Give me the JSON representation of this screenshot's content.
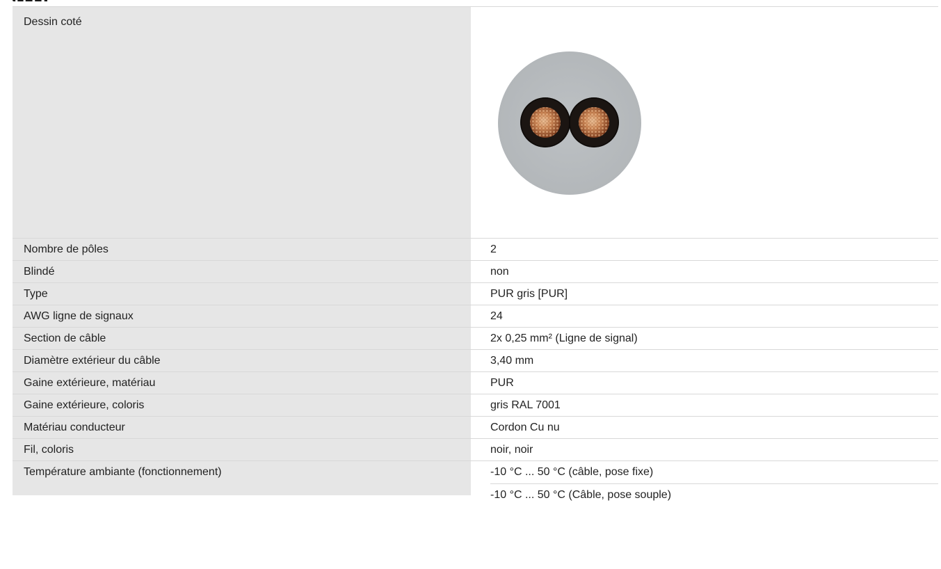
{
  "specs": {
    "drawing_label": "Dessin coté",
    "rows": [
      {
        "label": "Nombre de pôles",
        "value": "2"
      },
      {
        "label": "Blindé",
        "value": "non"
      },
      {
        "label": "Type",
        "value": "PUR gris [PUR]"
      },
      {
        "label": "AWG ligne de signaux",
        "value": "24"
      },
      {
        "label": "Section de câble",
        "value": "2x 0,25 mm² (Ligne de signal)"
      },
      {
        "label": "Diamètre extérieur du câble",
        "value": "3,40 mm"
      },
      {
        "label": "Gaine extérieure, matériau",
        "value": "PUR"
      },
      {
        "label": "Gaine extérieure, coloris",
        "value": "gris RAL 7001"
      },
      {
        "label": "Matériau conducteur",
        "value": "Cordon Cu nu"
      },
      {
        "label": "Fil, coloris",
        "value": "noir, noir"
      }
    ],
    "temperature": {
      "label": "Température ambiante (fonctionnement)",
      "values": [
        "-10 °C ... 50 °C (câble, pose fixe)",
        "-10 °C ... 50 °C (Câble, pose souple)"
      ]
    }
  },
  "colors": {
    "label_bg": "#e6e6e6",
    "sheath": "#b8bcc0",
    "conductor_insulation": "#1b1512",
    "copper": "#c07a4a"
  }
}
